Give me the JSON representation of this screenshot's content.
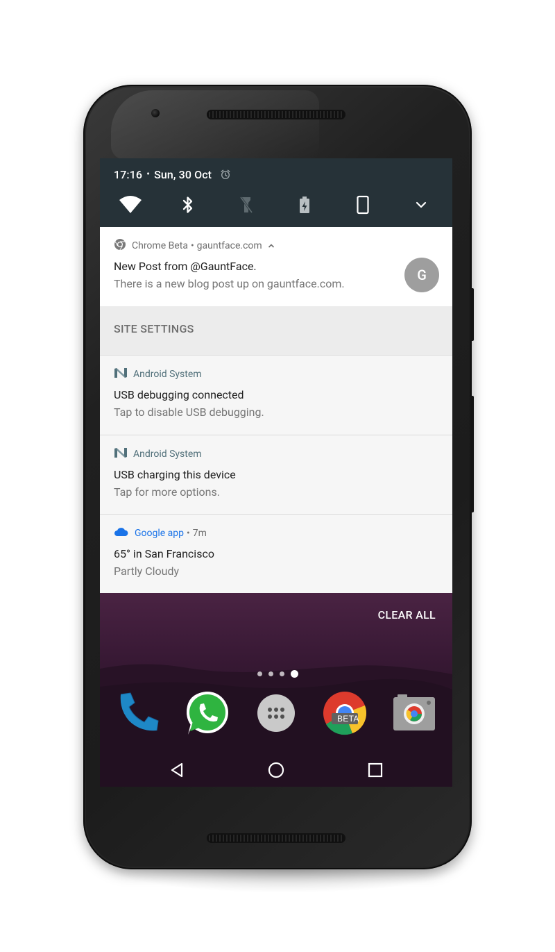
{
  "status": {
    "time": "17:16",
    "separator": "•",
    "date": "Sun, 30 Oct",
    "quick_settings": [
      "wifi-icon",
      "bluetooth-icon",
      "flashlight-off-icon",
      "battery-saver-icon",
      "rotation-portrait-icon",
      "expand-icon"
    ]
  },
  "notifications": {
    "chrome": {
      "app_name": "Chrome Beta",
      "separator": "•",
      "origin": "gauntface.com",
      "title": "New Post from @GauntFace.",
      "text": "There is a new blog post up on gauntface.com.",
      "avatar_letter": "G",
      "action": "SITE SETTINGS"
    },
    "adb": {
      "app_name": "Android System",
      "title": "USB debugging connected",
      "text": "Tap to disable USB debugging."
    },
    "usb": {
      "app_name": "Android System",
      "title": "USB charging this device",
      "text": "Tap for more options."
    },
    "google": {
      "app_name": "Google app",
      "separator": "•",
      "time": "7m",
      "title": "65° in San Francisco",
      "text": "Partly Cloudy"
    }
  },
  "home": {
    "clear_all": "CLEAR ALL",
    "chrome_badge": "BETA",
    "dock": [
      "phone-app-icon",
      "whatsapp-app-icon",
      "app-drawer-icon",
      "chrome-beta-app-icon",
      "camera-app-icon"
    ],
    "page_count": 4,
    "active_page": 4
  },
  "colors": {
    "status_bg": "#263238",
    "google_blue": "#1a73e8",
    "android_teal": "#51707a",
    "home_bg": "#3a1a36"
  }
}
